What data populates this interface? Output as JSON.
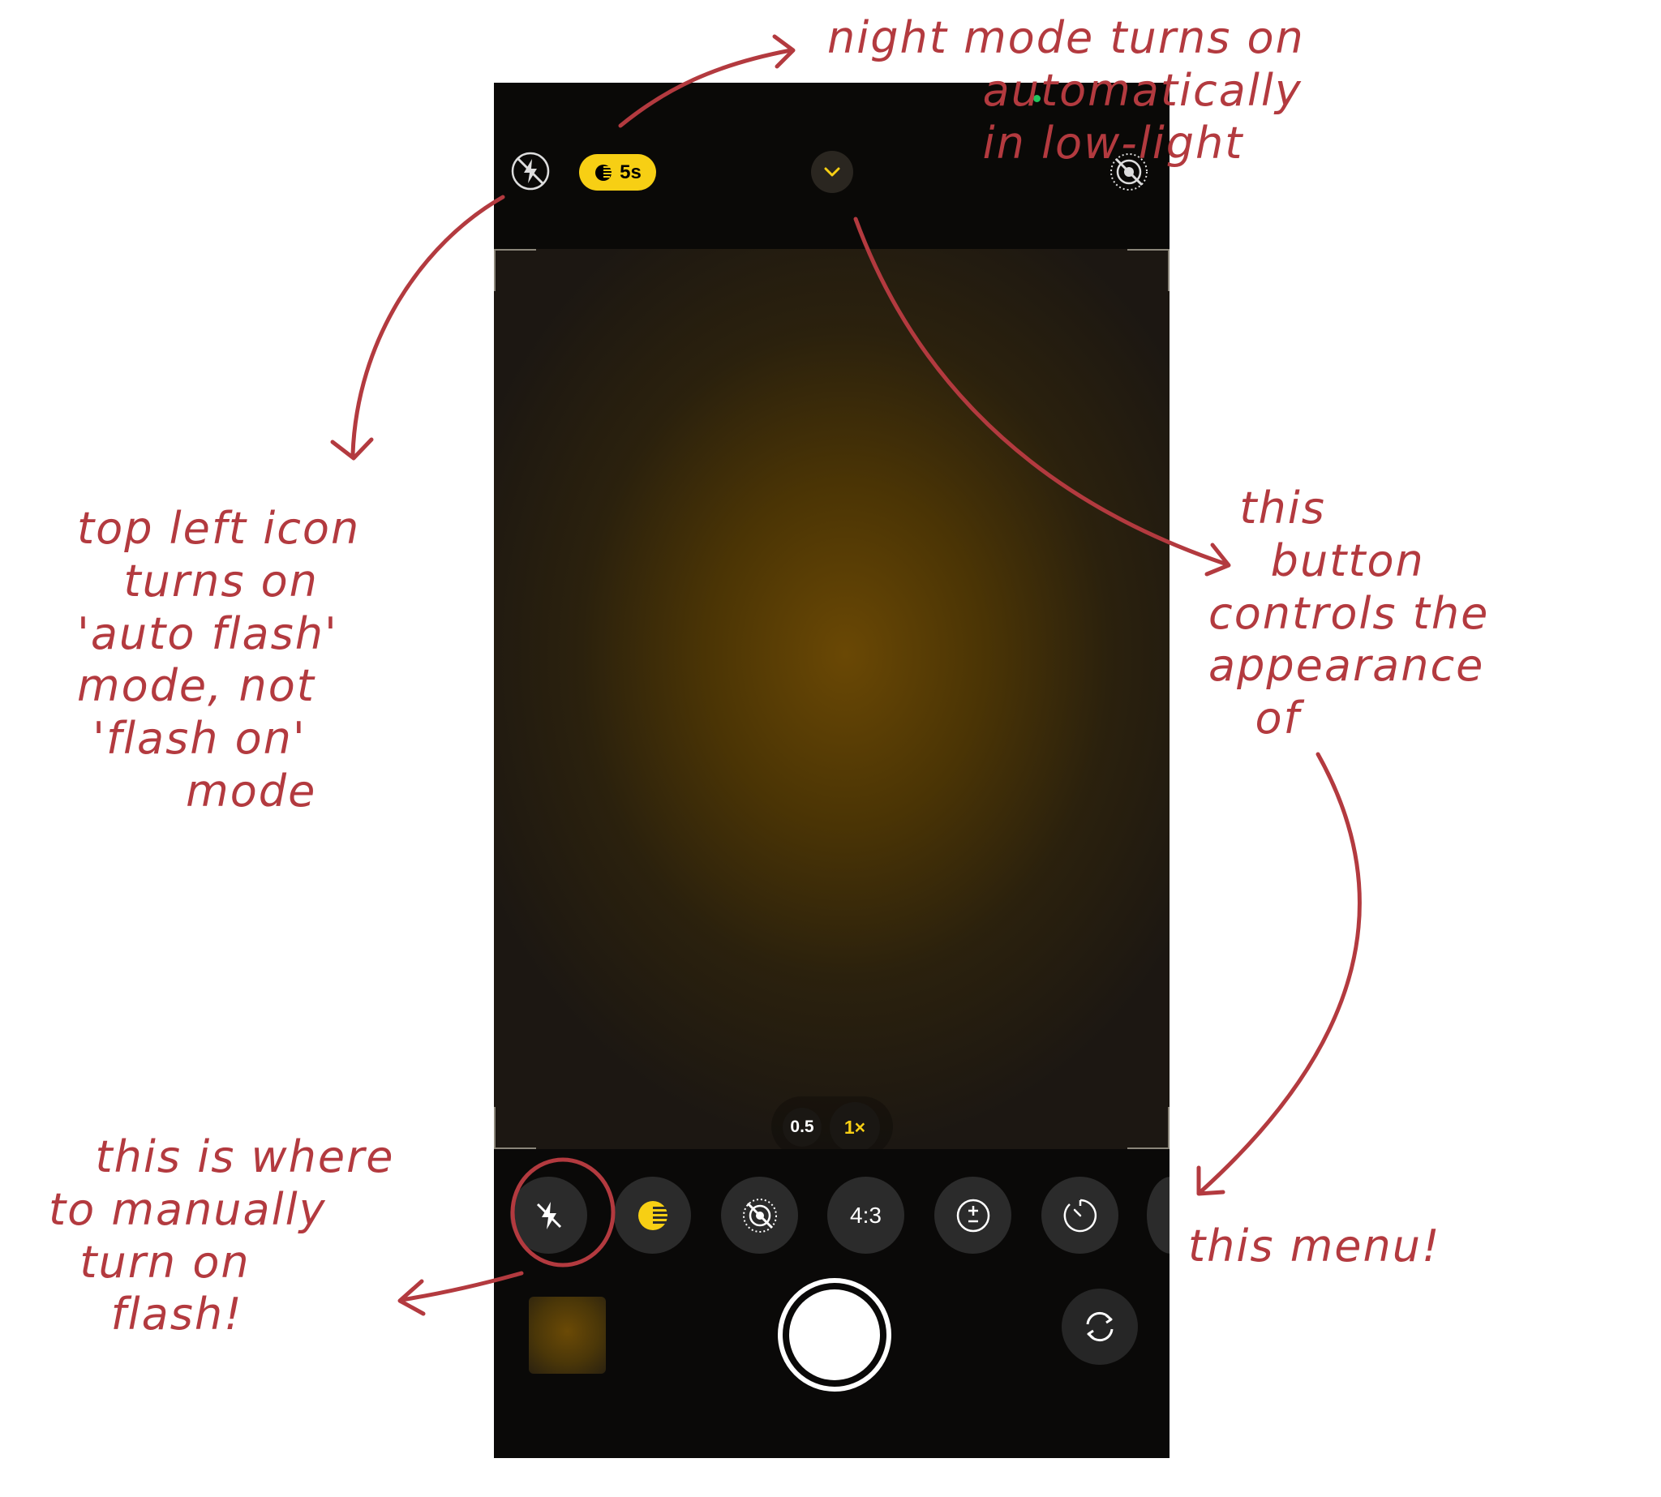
{
  "camera": {
    "night_mode_label": "5s",
    "zoom": {
      "wide": "0.5",
      "main": "1×"
    },
    "aspect_ratio": "4:3",
    "accent_color": "#f7cf14",
    "icons": {
      "top_flash": "flash-off-icon",
      "night": "night-mode-icon",
      "chevron": "chevron-down-icon",
      "live": "live-photo-off-icon",
      "menu_flash": "flash-off-icon",
      "menu_night": "night-mode-icon",
      "menu_live": "live-photo-off-icon",
      "menu_exposure": "exposure-icon",
      "menu_timer": "timer-icon",
      "flip": "camera-flip-icon"
    }
  },
  "annotations": {
    "color": "#b33a3f",
    "night_mode": "night mode turns on\n          automatically\n          in low-light",
    "top_left_icon": "top left icon\n   turns on\n'auto flash'\nmode, not\n 'flash on'\n       mode",
    "chevron_button": "  this\n    button\ncontrols the\nappearance\n   of",
    "menu": "this menu!",
    "manual_flash": "   this is where\nto manually\n  turn on\n    flash!"
  }
}
